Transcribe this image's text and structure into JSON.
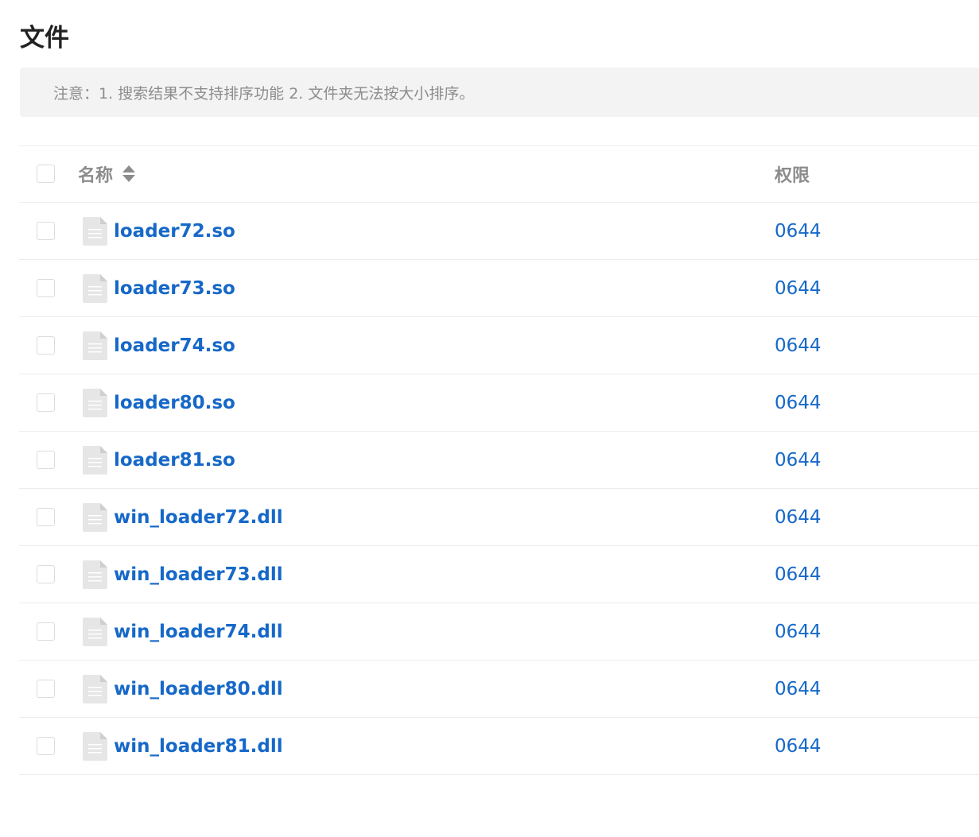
{
  "page": {
    "title": "文件",
    "notice": "注意：1. 搜索结果不支持排序功能 2. 文件夹无法按大小排序。"
  },
  "table": {
    "headers": {
      "name": "名称",
      "permission": "权限"
    },
    "rows": [
      {
        "name": "loader72.so",
        "permission": "0644"
      },
      {
        "name": "loader73.so",
        "permission": "0644"
      },
      {
        "name": "loader74.so",
        "permission": "0644"
      },
      {
        "name": "loader80.so",
        "permission": "0644"
      },
      {
        "name": "loader81.so",
        "permission": "0644"
      },
      {
        "name": "win_loader72.dll",
        "permission": "0644"
      },
      {
        "name": "win_loader73.dll",
        "permission": "0644"
      },
      {
        "name": "win_loader74.dll",
        "permission": "0644"
      },
      {
        "name": "win_loader80.dll",
        "permission": "0644"
      },
      {
        "name": "win_loader81.dll",
        "permission": "0644"
      }
    ]
  },
  "icons": {
    "file": "file-icon",
    "sort": "sort-icon"
  },
  "colors": {
    "link": "#1668c8",
    "muted": "#8c8c8c",
    "notice_bg": "#f3f3f3",
    "border": "#ececec"
  }
}
